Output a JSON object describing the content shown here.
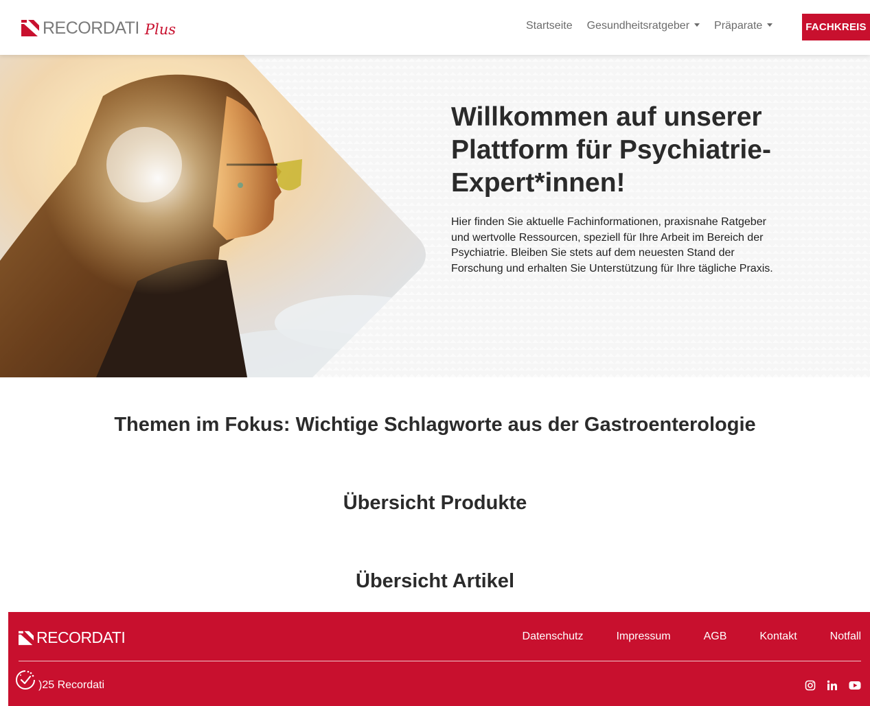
{
  "header": {
    "brand": "RECORDATI",
    "brand_suffix": "Plus",
    "nav": [
      {
        "label": "Startseite",
        "dropdown": false
      },
      {
        "label": "Gesundheitsratgeber",
        "dropdown": true
      },
      {
        "label": "Präparate",
        "dropdown": true
      }
    ],
    "cta_label": "FACHKREIS"
  },
  "hero": {
    "title": "Willkommen auf unserer Plattform für Psychiatrie-Expert*innen!",
    "description": "Hier finden Sie aktuelle Fachinformationen, praxisnahe Ratgeber und wertvolle Ressourcen, speziell für Ihre Arbeit im Bereich der Psychiatrie. Bleiben Sie stets auf dem neuesten Stand der Forschung und erhalten Sie Unterstützung für Ihre tägliche Praxis."
  },
  "sections": {
    "topics": "Themen im Fokus: Wichtige Schlagworte aus der Gastroenterologie",
    "products": "Übersicht Produkte",
    "articles": "Übersicht Artikel"
  },
  "footer": {
    "brand": "RECORDATI",
    "links": [
      "Datenschutz",
      "Impressum",
      "AGB",
      "Kontakt",
      "Notfall"
    ],
    "copyright": ")25 Recordati",
    "socials": [
      "instagram-icon",
      "linkedin-icon",
      "youtube-icon"
    ]
  },
  "colors": {
    "accent": "#c8102e",
    "text": "#2b2b2b",
    "nav_text": "#6b6b6b"
  }
}
